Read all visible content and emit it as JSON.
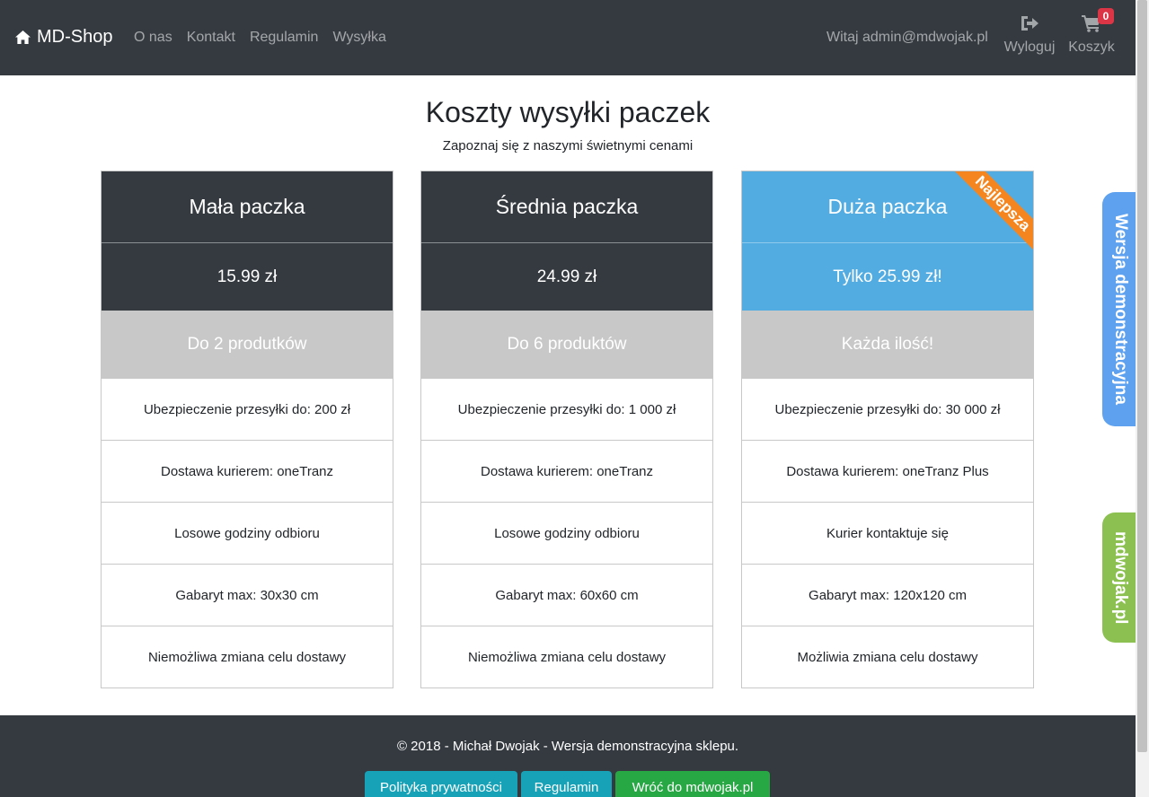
{
  "navbar": {
    "brand": "MD-Shop",
    "brand_icon": "home-icon",
    "links": [
      "O nas",
      "Kontakt",
      "Regulamin",
      "Wysyłka"
    ],
    "welcome": "Witaj admin@mdwojak.pl",
    "logout_label": "Wyloguj",
    "logout_icon": "sign-out-icon",
    "cart_label": "Koszyk",
    "cart_icon": "shopping-cart-icon",
    "cart_count": "0"
  },
  "page": {
    "title": "Koszty wysyłki paczek",
    "subtitle": "Zapoznaj się z naszymi świetnymi cenami"
  },
  "plans": [
    {
      "name": "Mała paczka",
      "price": "15.99 zł",
      "limit": "Do 2 produtków",
      "features": [
        "Ubezpieczenie przesyłki do: 200 zł",
        "Dostawa kurierem: oneTranz",
        "Losowe godziny odbioru",
        "Gabaryt max: 30x30 cm",
        "Niemożliwa zmiana celu dostawy"
      ]
    },
    {
      "name": "Średnia paczka",
      "price": "24.99 zł",
      "limit": "Do 6 produktów",
      "features": [
        "Ubezpieczenie przesyłki do: 1 000 zł",
        "Dostawa kurierem: oneTranz",
        "Losowe godziny odbioru",
        "Gabaryt max: 60x60 cm",
        "Niemożliwa zmiana celu dostawy"
      ]
    },
    {
      "name": "Duża paczka",
      "price": "Tylko 25.99 zł!",
      "limit": "Każda ilość!",
      "ribbon": "Najlepsza",
      "features": [
        "Ubezpieczenie przesyłki do: 30 000 zł",
        "Dostawa kurierem: oneTranz Plus",
        "Kurier kontaktuje się",
        "Gabaryt max: 120x120 cm",
        "Możliwia zmiana celu dostawy"
      ]
    }
  ],
  "side_tabs": {
    "demo": "Wersja demonstracyjna",
    "site": "mdwojak.pl"
  },
  "footer": {
    "text": "© 2018 - Michał Dwojak - Wersja demonstracyjna sklepu.",
    "privacy": "Polityka prywatności",
    "terms": "Regulamin",
    "back": "Wróć do mdwojak.pl"
  },
  "colors": {
    "navbar": "#343a40",
    "featured": "#52ace2",
    "ribbon": "#f5861f",
    "limit_row": "#c8c8c8",
    "demo_tab": "#5ea1ee",
    "site_tab": "#8cc152",
    "info_button": "#17a2b8",
    "success_button": "#28a745",
    "badge": "#dc3545"
  }
}
